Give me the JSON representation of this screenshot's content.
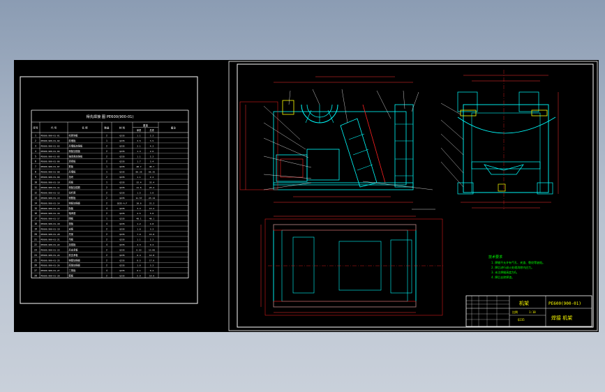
{
  "colors": {
    "background": "#000000",
    "frame": "#ffffff",
    "geometry": "#00ffff",
    "hidden_lines": "#ff2020",
    "dimensions": "#ff3030",
    "notes": "#00ff00",
    "highlight": "#ffff00",
    "text": "#ffffff"
  },
  "bom": {
    "title": "得先焊接 图 PE600(900-01)",
    "headers": {
      "no": "序号",
      "code": "代 号",
      "name": "名 称",
      "qty": "数量",
      "material": "材 料",
      "weight": "重量",
      "unit_weight": "单重",
      "total_weight": "总重",
      "remark": "备注"
    },
    "rows": [
      {
        "no": "1",
        "code": "PE600.900-01-01",
        "name": "机架侧板",
        "qty": "2",
        "mat": "Q235",
        "w1": "1.1",
        "w2": "2.2"
      },
      {
        "no": "2",
        "code": "PE600.900-01-02",
        "name": "前墙板",
        "qty": "1",
        "mat": "Q235",
        "w1": "3.5",
        "w2": "3.5"
      },
      {
        "no": "3",
        "code": "PE600.900-01-03",
        "name": "后墙板加强板",
        "qty": "2",
        "mat": "Q235",
        "w1": "2.1",
        "w2": "4.2"
      },
      {
        "no": "4",
        "code": "PE600.900-01-04",
        "name": "侧板加强板",
        "qty": "2",
        "mat": "Q235",
        "w1": "1.3",
        "w2": "2.6"
      },
      {
        "no": "5",
        "code": "PE600.900-01-05",
        "name": "轴承座加强板",
        "qty": "2",
        "mat": "Q235",
        "w1": "1.1",
        "w2": "2.2"
      },
      {
        "no": "6",
        "code": "PE600.900-01-06",
        "name": "连接板",
        "qty": "2",
        "mat": "Q235",
        "w1": "1.7",
        "w2": "3.4"
      },
      {
        "no": "7",
        "code": "PE600.900-01-07",
        "name": "筋板",
        "qty": "1",
        "mat": "Q235",
        "w1": "40.7",
        "w2": "40.7"
      },
      {
        "no": "8",
        "code": "PE600.900-01-08",
        "name": "后墙板",
        "qty": "1",
        "mat": "Q235",
        "w1": "66.35",
        "w2": "66.35"
      },
      {
        "no": "9",
        "code": "PE600.900-01-09",
        "name": "挡块",
        "qty": "2",
        "mat": "Q235",
        "w1": "1.1",
        "w2": "2.2"
      },
      {
        "no": "10",
        "code": "PE600.900-01-10",
        "name": "底板",
        "qty": "1",
        "mat": "Q235",
        "w1": "32.4",
        "w2": "32.4"
      },
      {
        "no": "11",
        "code": "PE600.900-01-11",
        "name": "侧板加强筋",
        "qty": "2",
        "mat": "Q235",
        "w1": "11.6",
        "w2": "23.2"
      },
      {
        "no": "12",
        "code": "PE600.900-01-12",
        "name": "拉杆座",
        "qty": "2",
        "mat": "Q235",
        "w1": "1.5",
        "w2": "3.0"
      },
      {
        "no": "13",
        "code": "PE600.900-01-13",
        "name": "侧筋板",
        "qty": "2",
        "mat": "Q235",
        "w1": "11.57",
        "w2": "23.14"
      },
      {
        "no": "14",
        "code": "PE600.900-01-14",
        "name": "侧板加强板",
        "qty": "2",
        "mat": "Q235-A.F",
        "w1": "10.6",
        "w2": "21.2"
      },
      {
        "no": "15",
        "code": "PE600.900-01-15",
        "name": "肋板",
        "qty": "4",
        "mat": "Q235",
        "w1": "3.3",
        "w2": "13.2"
      },
      {
        "no": "16",
        "code": "PE600.900-01-16",
        "name": "轴承座",
        "qty": "2",
        "mat": "Q235",
        "w1": "2.5",
        "w2": "5.0"
      },
      {
        "no": "17",
        "code": "PE600.900-01-17",
        "name": "隔板",
        "qty": "1",
        "mat": "Q235",
        "w1": "48.1",
        "w2": "48.1"
      },
      {
        "no": "18",
        "code": "PE600.900-01-18",
        "name": "垫板",
        "qty": "4",
        "mat": "Q235",
        "w1": "1.2",
        "w2": "4.8"
      },
      {
        "no": "19",
        "code": "PE600.900-01-19",
        "name": "支板",
        "qty": "2",
        "mat": "Q235",
        "w1": "1.6",
        "w2": "3.2"
      },
      {
        "no": "20",
        "code": "PE600.900-01-20",
        "name": "托架",
        "qty": "2",
        "mat": "Q235",
        "w1": "7.9",
        "w2": "15.8"
      },
      {
        "no": "21",
        "code": "PE600.900-01-21",
        "name": "吊板",
        "qty": "2",
        "mat": "Q235",
        "w1": "1.1",
        "w2": "2.2"
      },
      {
        "no": "22",
        "code": "PE600.900-01-22",
        "name": "加强板",
        "qty": "4",
        "mat": "Q235",
        "w1": "2.3",
        "w2": "9.2"
      },
      {
        "no": "23",
        "code": "PE600.900-01-23",
        "name": "后支承板",
        "qty": "2",
        "mat": "Q235",
        "w1": "6.53",
        "w2": "13.06"
      },
      {
        "no": "24",
        "code": "PE600.900-01-24",
        "name": "前支承板",
        "qty": "2",
        "mat": "Q235",
        "w1": "6.4",
        "w2": "12.8"
      },
      {
        "no": "25",
        "code": "PE600.900-01-25",
        "name": "侧壁加强板",
        "qty": "2",
        "mat": "Q235",
        "w1": "8.5",
        "w2": "17.0"
      },
      {
        "no": "26",
        "code": "PE600.900-01-26",
        "name": "底角加强板",
        "qty": "2",
        "mat": "Q235",
        "w1": "1.6",
        "w2": "3.2"
      },
      {
        "no": "27",
        "code": "PE600.900-01-27",
        "name": "三角板",
        "qty": "4",
        "mat": "Q235",
        "w1": "0.1",
        "w2": "0.4"
      },
      {
        "no": "28",
        "code": "PE600.900-01-28",
        "name": "筋板",
        "qty": "2",
        "mat": "Q235",
        "w1": "5.0",
        "w2": "10.0"
      }
    ]
  },
  "notes": {
    "heading": "技术要求",
    "lines": [
      "1. 焊缝不允许有气孔、夹渣、裂纹等缺陷。",
      "2. 焊后进行退火处理消除内应力。",
      "3. 未注焊缝高度为6。",
      "4. 焊后去除焊渣。"
    ]
  },
  "title_block": {
    "name": "机架",
    "drawing_no": "PE600(900-01)",
    "scale_label": "比例",
    "scale": "1:10",
    "material_label": "Q235",
    "footer": "焊接 机架"
  }
}
